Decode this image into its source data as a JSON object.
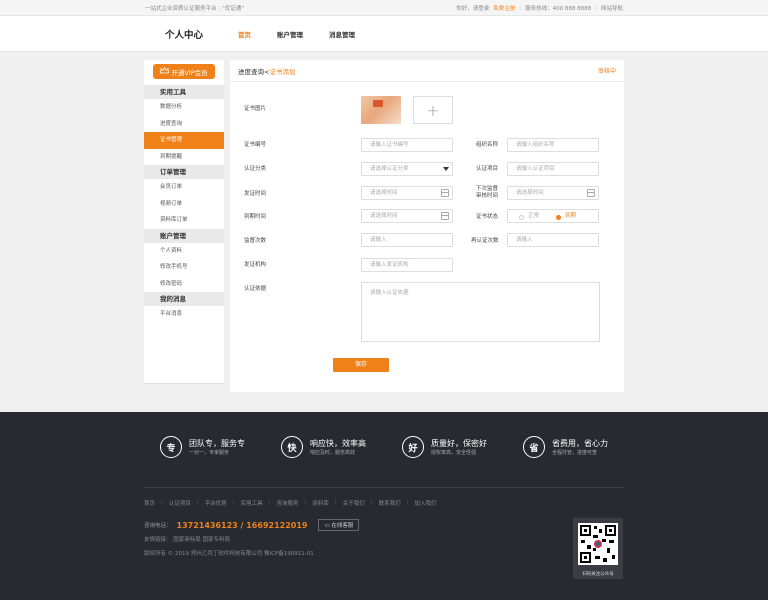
{
  "topbar": {
    "slogan": "一站式企业资质认证服务平台",
    "tag": "“优证通”",
    "greeting": "你好，请登录",
    "register": "免费注册",
    "hotline_label": "服务热线：",
    "hotline": "400 888 8888",
    "sitemap": "网站导航"
  },
  "header": {
    "title": "个人中心",
    "nav": [
      "首页",
      "账户管理",
      "消息管理"
    ]
  },
  "sidebar": {
    "vip_label": "开通VIP会员",
    "sections": [
      {
        "title": "实用工具",
        "items": [
          "数据分析",
          "进度查询",
          "证书管理",
          "到期提醒"
        ]
      },
      {
        "title": "订单管理",
        "items": [
          "会员订单",
          "视频订单",
          "资料库订单"
        ]
      },
      {
        "title": "账户管理",
        "items": [
          "个人资料",
          "修改手机号",
          "修改密码"
        ]
      },
      {
        "title": "我的消息",
        "items": [
          "平台消息"
        ]
      }
    ]
  },
  "content": {
    "crumb1": "进度查询<",
    "crumb2": "证书添加",
    "status": "审核中",
    "cert_image_label": "证书图片",
    "fields": {
      "cert_no": {
        "label": "证书编号",
        "placeholder": "请输入证书编号"
      },
      "org": {
        "label": "组织名称",
        "placeholder": "请输入组织名称"
      },
      "category": {
        "label": "认证分类",
        "placeholder": "请选择认证分类"
      },
      "project": {
        "label": "认证项目",
        "placeholder": "请输入认证项目"
      },
      "issue_time": {
        "label": "发证时间",
        "placeholder": "请选择时间"
      },
      "next_audit": {
        "label1": "下次监督",
        "label2": "审核时间",
        "placeholder": "请选择时间"
      },
      "expire": {
        "label": "到期时间",
        "placeholder": "请选择时间"
      },
      "cert_status": {
        "label": "证书状态",
        "opt1": "正常",
        "opt2": "到期"
      },
      "audit_count": {
        "label": "监督次数",
        "placeholder": "请输入"
      },
      "recert_count": {
        "label": "再认证次数",
        "placeholder": "请输入"
      },
      "issuer": {
        "label": "发证机构",
        "placeholder": "请输入发证机构"
      },
      "basis": {
        "label": "认证依据",
        "placeholder": "请输入认证依据"
      }
    },
    "save": "保存"
  },
  "footer": {
    "features": [
      {
        "icon": "专",
        "title": "团队专，服务专",
        "sub": "一对一，专家服务"
      },
      {
        "icon": "快",
        "title": "响应快，效率高",
        "sub": "响应及时，服务高效"
      },
      {
        "icon": "好",
        "title": "质量好，保密好",
        "sub": "授权率高，安全性强"
      },
      {
        "icon": "省",
        "title": "省费用，省心力",
        "sub": "全程托管，进度可查"
      }
    ],
    "links": [
      "首页",
      "认证项目",
      "平台优势",
      "实用工具",
      "咨询服务",
      "资料库",
      "关于我们",
      "联系我们",
      "加入我们"
    ],
    "hotline_label": "咨询电话：",
    "hotline": "13721436123 / 16692122019",
    "online": "在线客服",
    "friend_links": "友情链接：   国家商标局   国家专利局",
    "copyright": "版权所有 © 2019 郑州乙丙丁软件科技有限公司    豫ICP备190911-01",
    "qr_caption": "扫码关注公众号"
  }
}
